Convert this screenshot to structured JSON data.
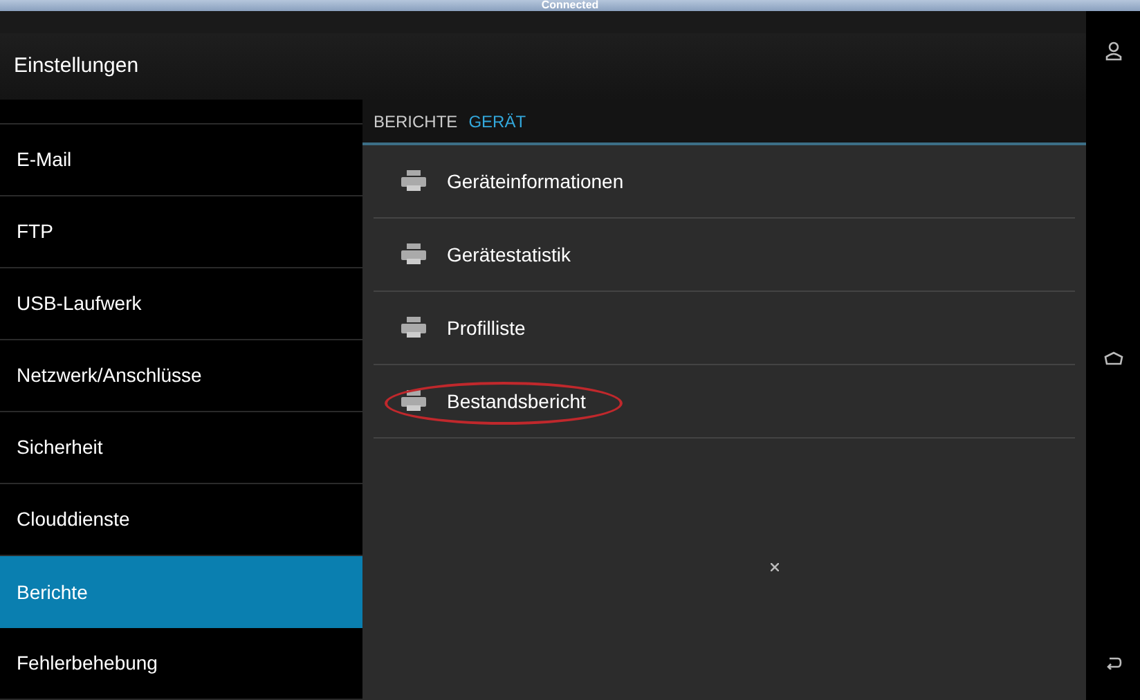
{
  "status_bar": {
    "text": "Connected"
  },
  "header": {
    "title": "Einstellungen"
  },
  "sidebar": {
    "items": [
      {
        "label": "E-Mail",
        "selected": false
      },
      {
        "label": "FTP",
        "selected": false
      },
      {
        "label": "USB-Laufwerk",
        "selected": false
      },
      {
        "label": "Netzwerk/Anschlüsse",
        "selected": false
      },
      {
        "label": "Sicherheit",
        "selected": false
      },
      {
        "label": "Clouddienste",
        "selected": false
      },
      {
        "label": "Berichte",
        "selected": true
      },
      {
        "label": "Fehlerbehebung",
        "selected": false
      }
    ]
  },
  "breadcrumb": [
    {
      "label": "BERICHTE",
      "selected": false
    },
    {
      "label": "GERÄT",
      "selected": true
    }
  ],
  "reports": [
    {
      "label": "Geräteinformationen",
      "circled": false
    },
    {
      "label": "Gerätestatistik",
      "circled": false
    },
    {
      "label": "Profilliste",
      "circled": false
    },
    {
      "label": "Bestandsbericht",
      "circled": true
    }
  ]
}
